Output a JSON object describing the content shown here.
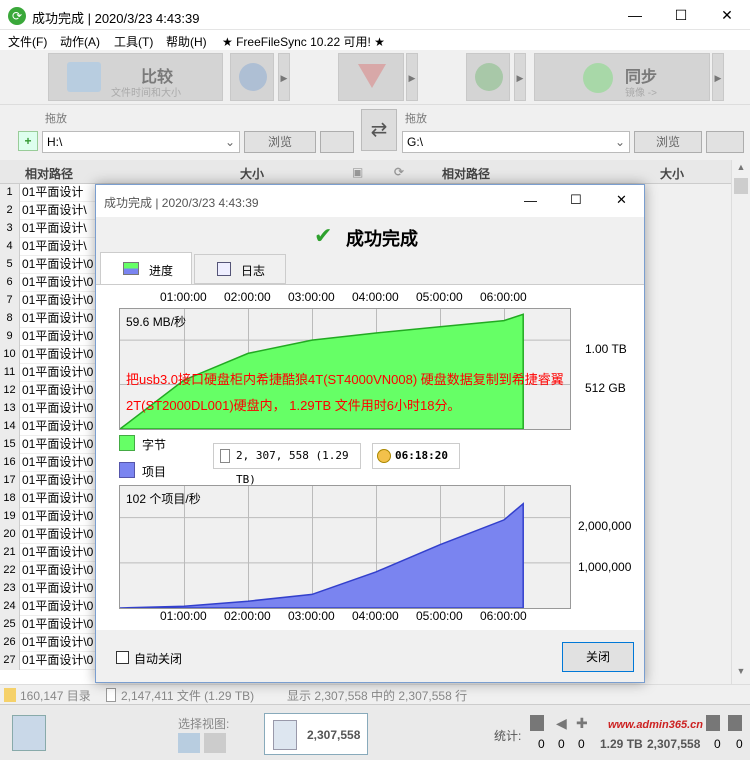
{
  "window": {
    "title": "成功完成 | 2020/3/23 4:43:39",
    "min": "—",
    "max": "☐",
    "close": "✕"
  },
  "menu": {
    "file": "文件(F)",
    "action": "动作(A)",
    "tools": "工具(T)",
    "help": "帮助(H)",
    "update": "★ FreeFileSync 10.22 可用! ★"
  },
  "toolbar": {
    "compare_label": "比较",
    "compare_sub": "文件时间和大小",
    "sync_label": "同步",
    "sync_sub": "镜像 ->"
  },
  "left_pane": {
    "drop_label": "拖放",
    "path": "H:\\",
    "browse": "浏览"
  },
  "right_pane": {
    "drop_label": "拖放",
    "path": "G:\\",
    "browse": "浏览"
  },
  "grid": {
    "col_path": "相对路径",
    "col_size": "大小",
    "rows": [
      {
        "n": "1",
        "p": "01平面设计"
      },
      {
        "n": "2",
        "p": "01平面设计\\"
      },
      {
        "n": "3",
        "p": "01平面设计\\"
      },
      {
        "n": "4",
        "p": "01平面设计\\"
      },
      {
        "n": "5",
        "p": "01平面设计\\0"
      },
      {
        "n": "6",
        "p": "01平面设计\\0"
      },
      {
        "n": "7",
        "p": "01平面设计\\0"
      },
      {
        "n": "8",
        "p": "01平面设计\\0"
      },
      {
        "n": "9",
        "p": "01平面设计\\0"
      },
      {
        "n": "10",
        "p": "01平面设计\\0"
      },
      {
        "n": "11",
        "p": "01平面设计\\0"
      },
      {
        "n": "12",
        "p": "01平面设计\\0"
      },
      {
        "n": "13",
        "p": "01平面设计\\0"
      },
      {
        "n": "14",
        "p": "01平面设计\\0"
      },
      {
        "n": "15",
        "p": "01平面设计\\0"
      },
      {
        "n": "16",
        "p": "01平面设计\\0"
      },
      {
        "n": "17",
        "p": "01平面设计\\0"
      },
      {
        "n": "18",
        "p": "01平面设计\\0"
      },
      {
        "n": "19",
        "p": "01平面设计\\0"
      },
      {
        "n": "20",
        "p": "01平面设计\\0"
      },
      {
        "n": "21",
        "p": "01平面设计\\0"
      },
      {
        "n": "22",
        "p": "01平面设计\\0"
      },
      {
        "n": "23",
        "p": "01平面设计\\0"
      },
      {
        "n": "24",
        "p": "01平面设计\\0"
      },
      {
        "n": "25",
        "p": "01平面设计\\0"
      },
      {
        "n": "26",
        "p": "01平面设计\\0"
      },
      {
        "n": "27",
        "p": "01平面设计\\0"
      }
    ]
  },
  "status": {
    "dirs": "160,147 目录",
    "files": "2,147,411 文件 (1.29 TB)",
    "shown": "显示 2,307,558 中的 2,307,558 行"
  },
  "bottom": {
    "select_view": "选择视图:",
    "count": "2,307,558",
    "stats_label": "统计:",
    "stats": [
      "0",
      "0",
      "0",
      "1.29 TB",
      "2,307,558",
      "0",
      "0"
    ],
    "watermark": "www.admin365.cn"
  },
  "dialog": {
    "title": "成功完成 | 2020/3/23 4:43:39",
    "headline": "成功完成",
    "tab_progress": "进度",
    "tab_log": "日志",
    "time_ticks": [
      "01:00:00",
      "02:00:00",
      "03:00:00",
      "04:00:00",
      "05:00:00",
      "06:00:00"
    ],
    "bytes_rate": "59.6 MB/秒",
    "bytes_ticks": [
      "1.00 TB",
      "512 GB"
    ],
    "annotation": "把usb3.0接口硬盘柜内希捷酷狼4T(ST4000VN008) 硬盘数据复制到希捷睿翼2T(ST2000DL001)硬盘内， 1.29TB 文件用时6小时18分。",
    "legend_bytes": "字节",
    "legend_items": "项目",
    "items_total": "2, 307, 558 (1.29 TB)",
    "elapsed": "06:18:20",
    "items_rate": "102 个项目/秒",
    "items_ticks": [
      "2,000,000",
      "1,000,000"
    ],
    "auto_close": "自动关闭",
    "close_button": "关闭",
    "colors": {
      "bytes": "#66ff66",
      "items": "#7a84f0",
      "check": "#2ea12e",
      "annotation": "#ff0000"
    }
  },
  "chart_data": [
    {
      "type": "area",
      "title": "",
      "series": [
        {
          "name": "字节",
          "x": [
            "00:00",
            "01:00",
            "02:00",
            "03:00",
            "04:00",
            "05:00",
            "06:00",
            "06:18"
          ],
          "values": [
            0.0,
            0.55,
            0.85,
            1.0,
            1.08,
            1.15,
            1.22,
            1.29
          ]
        }
      ],
      "yunit": "TB",
      "xlabel": "",
      "ylabel": ""
    },
    {
      "type": "area",
      "title": "",
      "series": [
        {
          "name": "项目",
          "x": [
            "00:00",
            "01:00",
            "02:00",
            "03:00",
            "04:00",
            "05:00",
            "06:00",
            "06:18"
          ],
          "values": [
            0,
            40000,
            150000,
            300000,
            800000,
            1400000,
            1950000,
            2307558
          ]
        }
      ],
      "xlabel": "",
      "ylabel": ""
    }
  ]
}
